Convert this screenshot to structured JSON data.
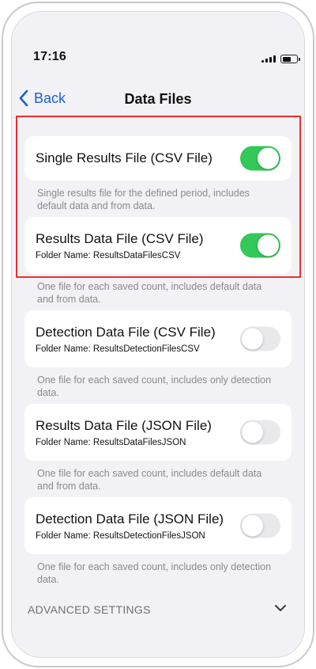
{
  "status_bar": {
    "time": "17:16"
  },
  "nav": {
    "back_label": "Back",
    "title": "Data Files"
  },
  "settings": [
    {
      "title": "Single Results File (CSV File)",
      "subtitle": "",
      "enabled": true,
      "footer": "Single results file for the defined period, includes default data and from data."
    },
    {
      "title": "Results Data File (CSV File)",
      "subtitle": "Folder Name: ResultsDataFilesCSV",
      "enabled": true,
      "footer": "One file for each saved count, includes default data and from data."
    },
    {
      "title": "Detection Data File (CSV File)",
      "subtitle": "Folder Name: ResultsDetectionFilesCSV",
      "enabled": false,
      "footer": "One file for each saved count, includes only detection data."
    },
    {
      "title": "Results Data File (JSON File)",
      "subtitle": "Folder Name: ResultsDataFilesJSON",
      "enabled": false,
      "footer": "One file for each saved count, includes default data and from data."
    },
    {
      "title": "Detection Data File (JSON File)",
      "subtitle": "Folder Name: ResultsDetectionFilesJSON",
      "enabled": false,
      "footer": "One file for each saved count, includes only detection data."
    }
  ],
  "advanced": {
    "label": "ADVANCED SETTINGS"
  },
  "colors": {
    "accent": "#1a5fd0",
    "toggle_on": "#34c759",
    "highlight": "#e8302f"
  },
  "icons": {
    "back": "chevron-left-icon",
    "expand": "chevron-down-icon"
  }
}
